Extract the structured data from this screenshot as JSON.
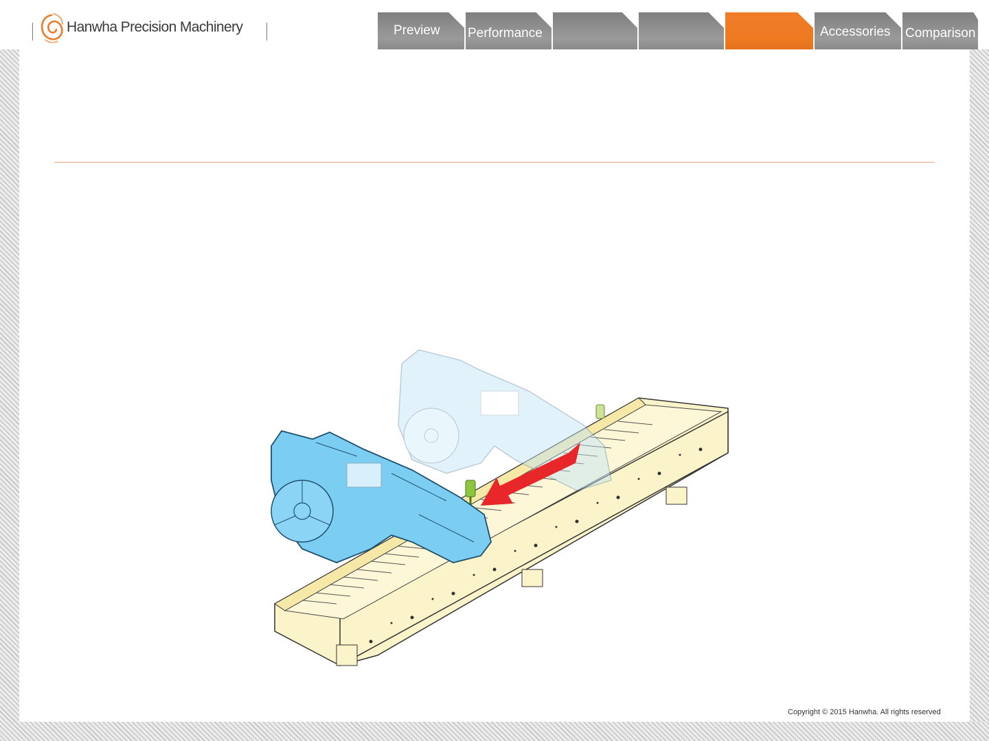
{
  "brand": {
    "name": "Hanwha Precision Machinery",
    "accent": "#ef7a22"
  },
  "nav": {
    "tabs": [
      {
        "label": "Preview",
        "active": false
      },
      {
        "label": "Performance",
        "active": false
      },
      {
        "label": "",
        "active": false
      },
      {
        "label": "",
        "active": false
      },
      {
        "label": "",
        "active": true
      },
      {
        "label": "Accessories",
        "active": false
      },
      {
        "label": "Comparison",
        "active": false
      }
    ]
  },
  "illustration": {
    "feeder_color": "#7ccdf2",
    "rail_color": "#fbf3c9",
    "arrow_color": "#e8272a",
    "pin_color": "#8cc63f"
  },
  "footer": {
    "copyright": "Copyright © 2015 Hanwha. All rights reserved"
  }
}
